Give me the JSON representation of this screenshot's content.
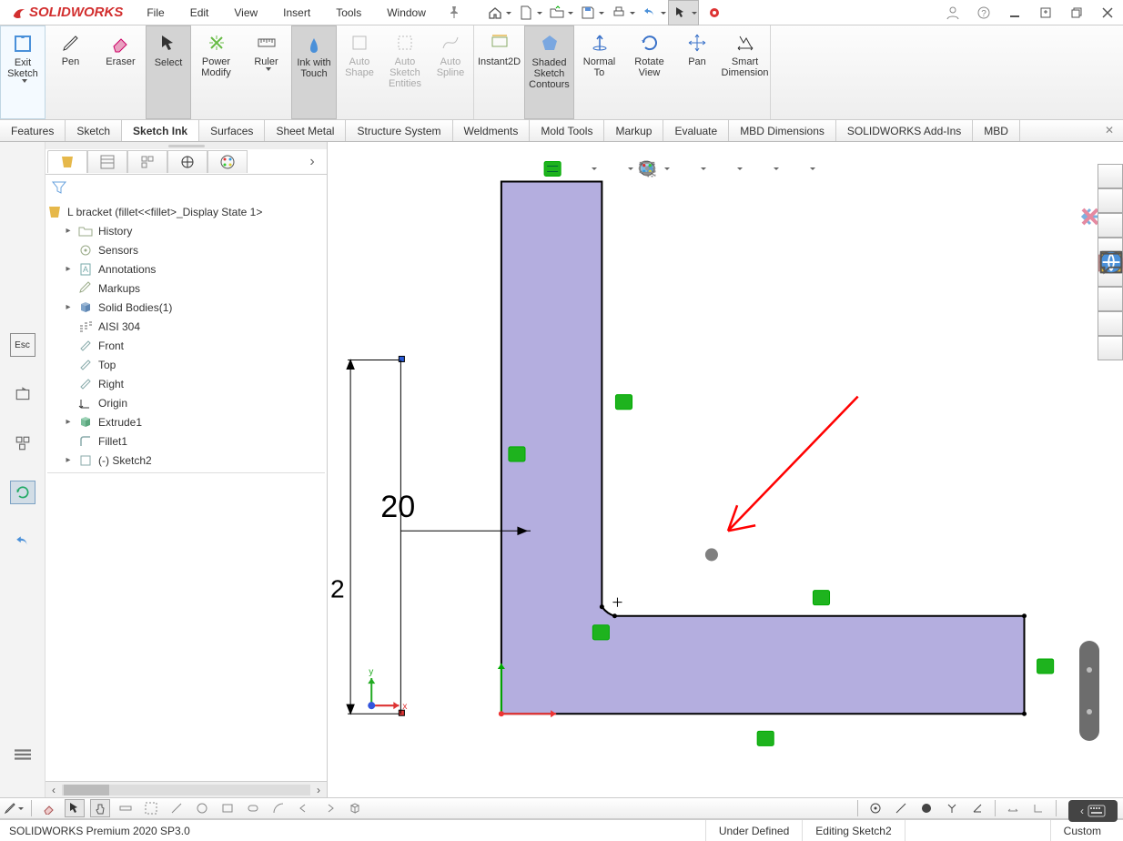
{
  "app": {
    "logo_text": "SOLIDWORKS"
  },
  "menu": [
    "File",
    "Edit",
    "View",
    "Insert",
    "Tools",
    "Window"
  ],
  "ribbon": {
    "groups": [
      {
        "id": "sketch",
        "buttons": [
          {
            "name": "exit-sketch",
            "label": "Exit\nSketch",
            "extra_class": "exit narrow",
            "has_drop": true
          },
          {
            "name": "pen",
            "label": "Pen"
          },
          {
            "name": "eraser",
            "label": "Eraser"
          },
          {
            "name": "select",
            "label": "Select",
            "extra_class": "selected narrow"
          },
          {
            "name": "power-modify",
            "label": "Power\nModify"
          },
          {
            "name": "ruler",
            "label": "Ruler",
            "has_drop": true
          },
          {
            "name": "ink-touch",
            "label": "Ink with\nTouch",
            "extra_class": "selected narrow"
          },
          {
            "name": "auto-shape",
            "label": "Auto\nShape",
            "extra_class": "disabled narrow"
          },
          {
            "name": "auto-sketch-entities",
            "label": "Auto\nSketch\nEntities",
            "extra_class": "disabled narrow"
          },
          {
            "name": "auto-spline",
            "label": "Auto\nSpline",
            "extra_class": "disabled narrow"
          }
        ]
      },
      {
        "id": "view",
        "buttons": [
          {
            "name": "instant2d",
            "label": "Instant2D"
          },
          {
            "name": "shaded-sketch-contours",
            "label": "Shaded\nSketch\nContours",
            "extra_class": "selected"
          },
          {
            "name": "normal-to",
            "label": "Normal\nTo"
          },
          {
            "name": "rotate-view",
            "label": "Rotate\nView"
          },
          {
            "name": "pan",
            "label": "Pan"
          },
          {
            "name": "smart-dimension",
            "label": "Smart\nDimension"
          }
        ]
      }
    ]
  },
  "cm_tabs": [
    "Features",
    "Sketch",
    "Sketch Ink",
    "Surfaces",
    "Sheet Metal",
    "Structure System",
    "Weldments",
    "Mold Tools",
    "Markup",
    "Evaluate",
    "MBD Dimensions",
    "SOLIDWORKS Add-Ins",
    "MBD"
  ],
  "cm_active_index": 2,
  "tree": {
    "root": "L bracket  (fillet<<fillet>_Display State 1>",
    "items": [
      {
        "label": "History",
        "icon": "folder",
        "toggle": true
      },
      {
        "label": "Sensors",
        "icon": "sensor"
      },
      {
        "label": "Annotations",
        "icon": "note",
        "toggle": true
      },
      {
        "label": "Markups",
        "icon": "markup"
      },
      {
        "label": "Solid Bodies(1)",
        "icon": "body",
        "toggle": true
      },
      {
        "label": "AISI 304",
        "icon": "material"
      },
      {
        "label": "Front",
        "icon": "plane"
      },
      {
        "label": "Top",
        "icon": "plane"
      },
      {
        "label": "Right",
        "icon": "plane"
      },
      {
        "label": "Origin",
        "icon": "origin"
      },
      {
        "label": "Extrude1",
        "icon": "feature",
        "toggle": true
      },
      {
        "label": "Fillet1",
        "icon": "fillet"
      },
      {
        "label": "(-) Sketch2",
        "icon": "sketch",
        "toggle": true
      }
    ]
  },
  "left_rail": {
    "buttons": [
      "esc",
      "open",
      "group",
      "refresh",
      "undo",
      "menu"
    ],
    "selected_index": 3,
    "esc_label": "Esc"
  },
  "dimension": {
    "label": "20"
  },
  "statusbar": {
    "left": "SOLIDWORKS Premium 2020 SP3.0",
    "mid": "Under Defined",
    "right": "Editing Sketch2",
    "custom": "Custom"
  }
}
